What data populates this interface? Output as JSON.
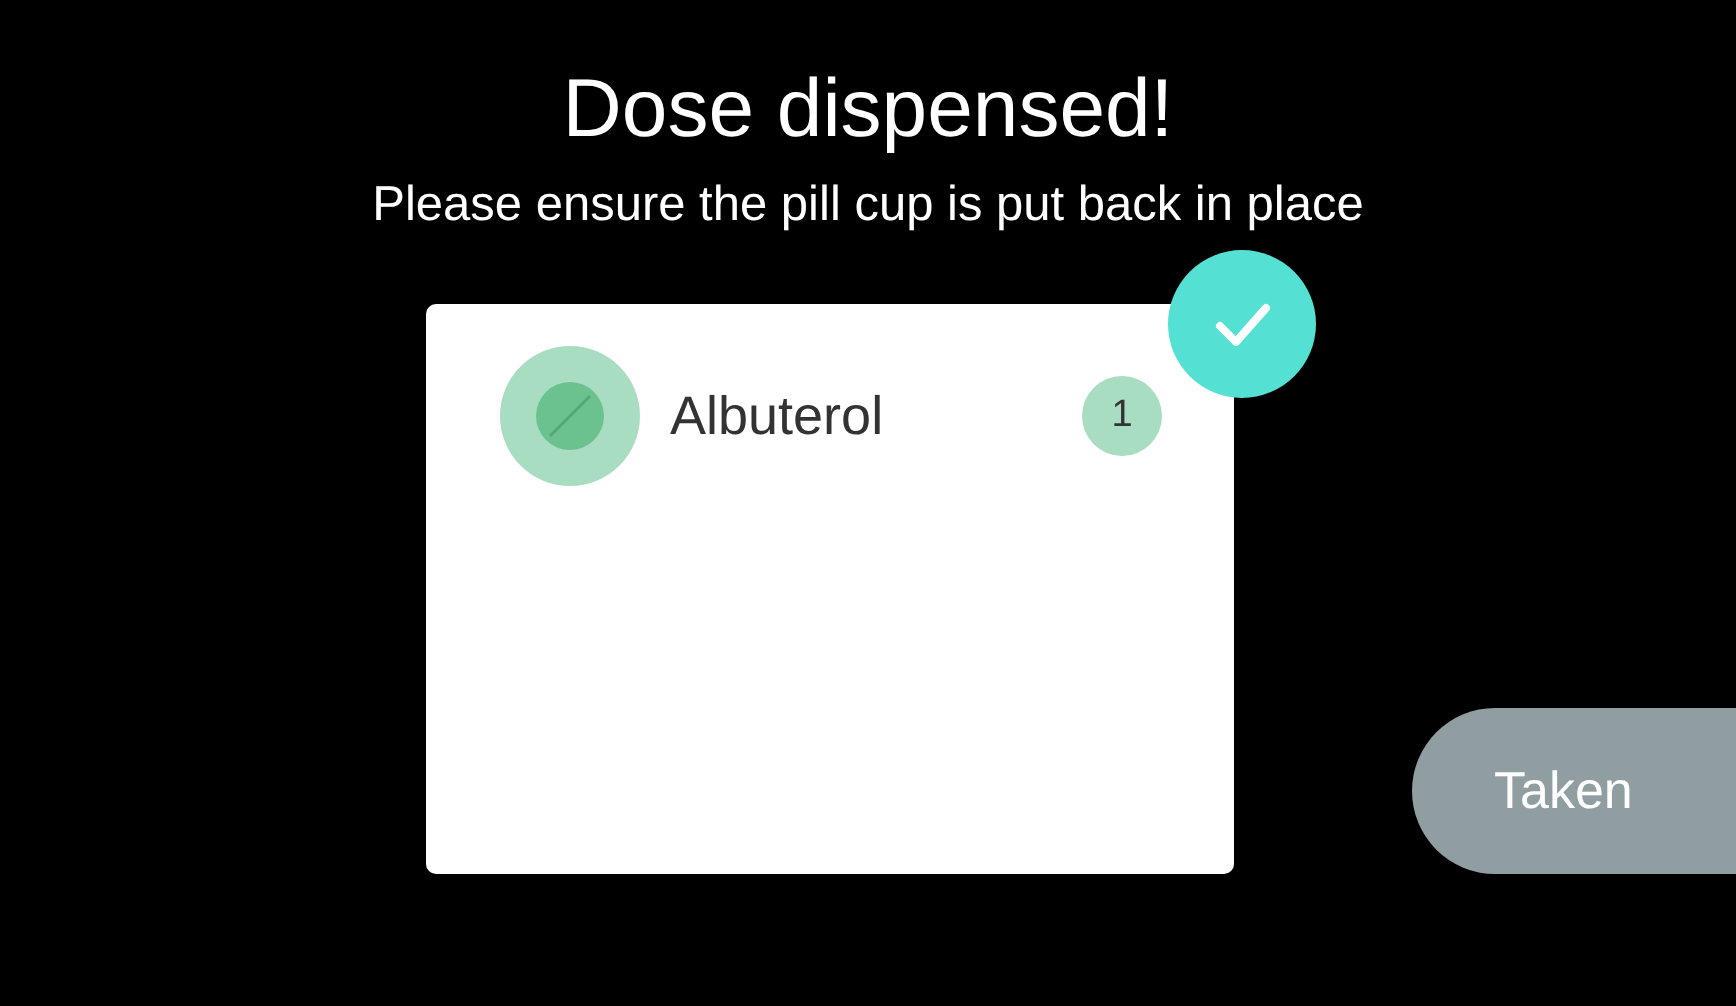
{
  "title": "Dose dispensed!",
  "message": "Please ensure the pill cup is put back in place",
  "card": {
    "confirmed": true,
    "medications": [
      {
        "name": "Albuterol",
        "count": "1"
      }
    ]
  },
  "button": "Taken"
}
